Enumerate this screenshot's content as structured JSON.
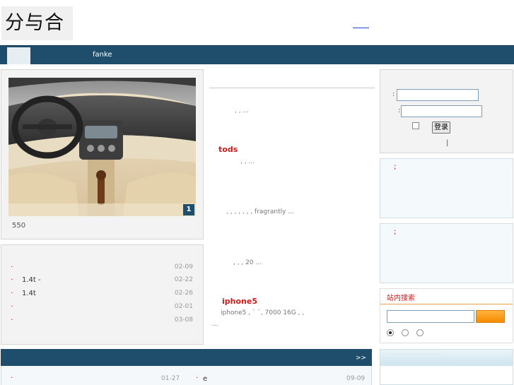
{
  "header": {
    "logo_text": "分与合"
  },
  "nav": {
    "items": [
      {
        "label": ""
      },
      {
        "label": "fanke"
      }
    ]
  },
  "slideshow": {
    "caption": "550",
    "current_index": "1"
  },
  "news": {
    "items": [
      {
        "bullet": "·",
        "title": "",
        "date": "02-09"
      },
      {
        "bullet": "·",
        "title": "1.4t   -",
        "date": "02-22"
      },
      {
        "bullet": "·",
        "title": "1.4t",
        "date": "02-26"
      },
      {
        "bullet": "·",
        "title": "",
        "date": "02-01"
      },
      {
        "bullet": "·",
        "title": "",
        "date": "03-08"
      }
    ]
  },
  "articles": {
    "a1": {
      "excerpt": ",                         ,  ..."
    },
    "a2": {
      "title": "tods",
      "excerpt": ",              ,                        ..."
    },
    "a3": {
      "excerpt": ",  , ,   ,    ,    ,          ,  fragrantly              ..."
    },
    "a4": {
      "excerpt": ",                        ,        ,      20 ..."
    },
    "a5": {
      "title": "iphone5",
      "excerpt_line1": "iphone5              ,    `   `,                        7000 16G  ,    ,",
      "excerpt_line2": "..."
    }
  },
  "login": {
    "username_colon": ":",
    "password_colon": ":",
    "submit_label": "登录",
    "separator": "|"
  },
  "notices": {
    "box1_mark": ";",
    "box2_mark": ";"
  },
  "search": {
    "title": "站内搜索",
    "input_value": ""
  },
  "bottom": {
    "more_label": ">>",
    "row": {
      "left_bullet": "·",
      "left_date": "01-27",
      "right_bullet": "·",
      "right_title": "e",
      "right_date": "09-09"
    }
  },
  "colors": {
    "nav_bg": "#1e4e6c",
    "accent_red": "#cc1a1a",
    "search_button": "#f58a00"
  }
}
